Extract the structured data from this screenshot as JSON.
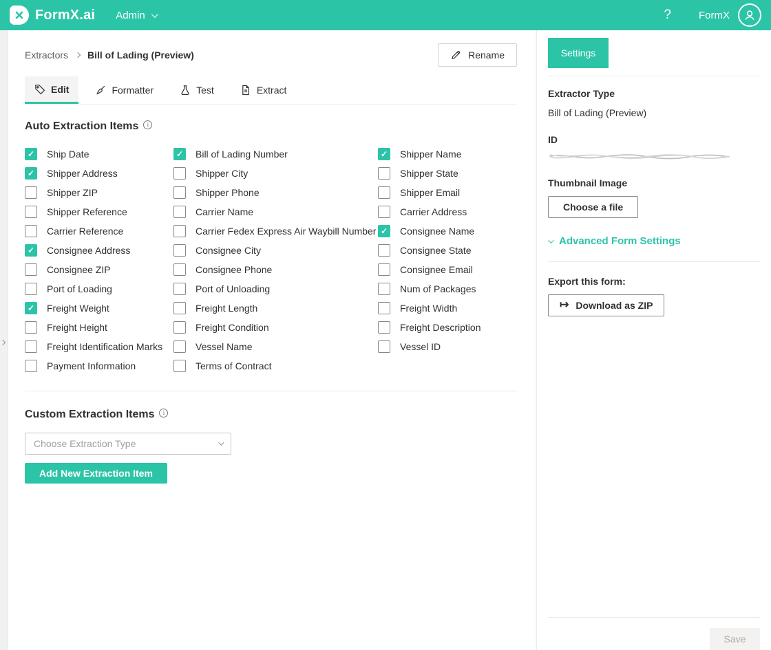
{
  "colors": {
    "accent": "#2CC4A7"
  },
  "header": {
    "logo": "FormX.ai",
    "admin_menu": "Admin",
    "help_label": "?",
    "account_name": "FormX"
  },
  "breadcrumb": {
    "root": "Extractors",
    "current": "Bill of Lading (Preview)"
  },
  "toolbar": {
    "rename_label": "Rename"
  },
  "tabs": [
    {
      "label": "Edit",
      "active": true
    },
    {
      "label": "Formatter",
      "active": false
    },
    {
      "label": "Test",
      "active": false
    },
    {
      "label": "Extract",
      "active": false
    }
  ],
  "auto_extraction": {
    "title": "Auto Extraction Items",
    "columns": [
      [
        {
          "label": "Ship Date",
          "checked": true
        },
        {
          "label": "Shipper Address",
          "checked": true
        },
        {
          "label": "Shipper ZIP",
          "checked": false
        },
        {
          "label": "Shipper Reference",
          "checked": false
        },
        {
          "label": "Carrier Reference",
          "checked": false
        },
        {
          "label": "Consignee Address",
          "checked": true
        },
        {
          "label": "Consignee ZIP",
          "checked": false
        },
        {
          "label": "Port of Loading",
          "checked": false
        },
        {
          "label": "Freight Weight",
          "checked": true
        },
        {
          "label": "Freight Height",
          "checked": false
        },
        {
          "label": "Freight Identification Marks",
          "checked": false
        },
        {
          "label": "Payment Information",
          "checked": false
        }
      ],
      [
        {
          "label": "Bill of Lading Number",
          "checked": true
        },
        {
          "label": "Shipper City",
          "checked": false
        },
        {
          "label": "Shipper Phone",
          "checked": false
        },
        {
          "label": "Carrier Name",
          "checked": false
        },
        {
          "label": "Carrier Fedex Express Air Waybill Number",
          "checked": false
        },
        {
          "label": "Consignee City",
          "checked": false
        },
        {
          "label": "Consignee Phone",
          "checked": false
        },
        {
          "label": "Port of Unloading",
          "checked": false
        },
        {
          "label": "Freight Length",
          "checked": false
        },
        {
          "label": "Freight Condition",
          "checked": false
        },
        {
          "label": "Vessel Name",
          "checked": false
        },
        {
          "label": "Terms of Contract",
          "checked": false
        }
      ],
      [
        {
          "label": "Shipper Name",
          "checked": true
        },
        {
          "label": "Shipper State",
          "checked": false
        },
        {
          "label": "Shipper Email",
          "checked": false
        },
        {
          "label": "Carrier Address",
          "checked": false
        },
        {
          "label": "Consignee Name",
          "checked": true
        },
        {
          "label": "Consignee State",
          "checked": false
        },
        {
          "label": "Consignee Email",
          "checked": false
        },
        {
          "label": "Num of Packages",
          "checked": false
        },
        {
          "label": "Freight Width",
          "checked": false
        },
        {
          "label": "Freight Description",
          "checked": false
        },
        {
          "label": "Vessel ID",
          "checked": false
        }
      ]
    ]
  },
  "custom_extraction": {
    "title": "Custom Extraction Items",
    "dropdown_placeholder": "Choose Extraction Type",
    "add_button_label": "Add New Extraction Item"
  },
  "settings_panel": {
    "tab_label": "Settings",
    "extractor_type_label": "Extractor Type",
    "extractor_type_value": "Bill of Lading (Preview)",
    "id_label": "ID",
    "thumbnail_label": "Thumbnail Image",
    "choose_file_label": "Choose a file",
    "advanced_settings_label": "Advanced Form Settings",
    "export_label": "Export this form:",
    "download_zip_label": "Download as ZIP",
    "save_label": "Save"
  }
}
